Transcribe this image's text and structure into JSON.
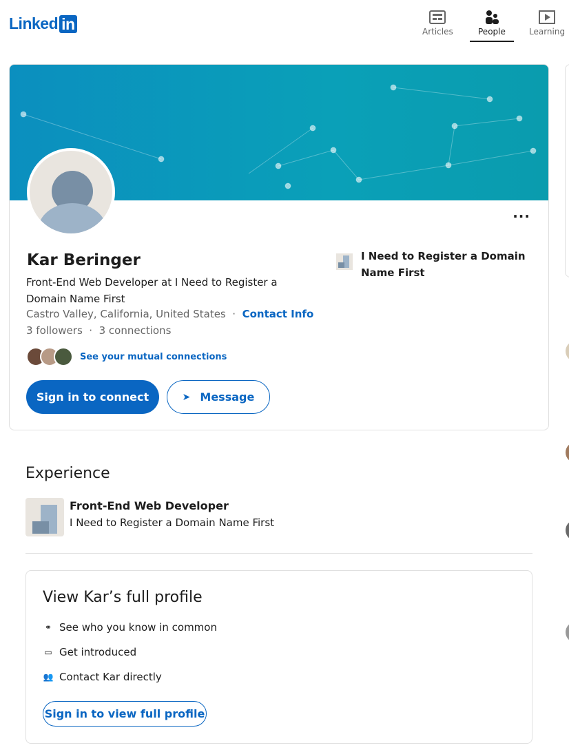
{
  "header": {
    "logo": "Linked",
    "logo_in": "in",
    "nav": [
      {
        "label": "Articles",
        "icon": "articles-icon"
      },
      {
        "label": "People",
        "icon": "people-icon",
        "active": true
      },
      {
        "label": "Learning",
        "icon": "learning-icon"
      }
    ]
  },
  "profile": {
    "name": "Kar Beringer",
    "headline": "Front-End Web Developer at I Need to Register a Domain Name First",
    "location": "Castro Valley, California, United States",
    "contact_info": "Contact Info",
    "followers": "3 followers",
    "connections": "3 connections",
    "mutual": "See your mutual connections",
    "connect_button": "Sign in to connect",
    "message_button": "Message",
    "current_company": "I Need to Register a Domain Name First"
  },
  "experience": {
    "title": "Experience",
    "items": [
      {
        "role": "Front-End Web Developer",
        "company": "I Need to Register a Domain Name First"
      }
    ]
  },
  "full_profile": {
    "title": "View Kar’s full profile",
    "items": [
      "See who you know in common",
      "Get introduced",
      "Contact Kar directly"
    ],
    "button": "Sign in to view full profile"
  },
  "colors": {
    "brand": "#0a66c2"
  }
}
